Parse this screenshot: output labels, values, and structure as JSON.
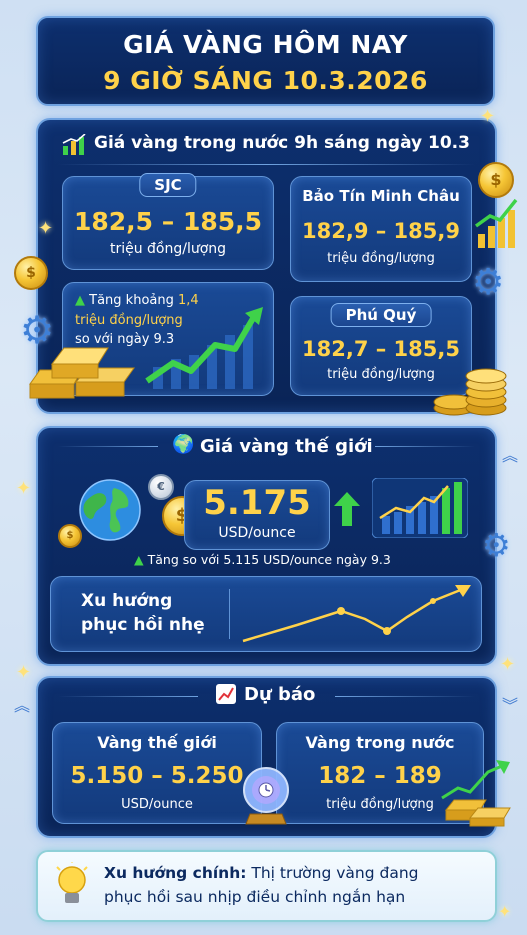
{
  "header": {
    "line1": "GIÁ VÀNG HÔM NAY",
    "line2": "9 GIỜ SÁNG 10.3.2026"
  },
  "domestic": {
    "title": "Giá vàng trong nước 9h sáng ngày 10.3",
    "sjc": {
      "name": "SJC",
      "price": "182,5 – 185,5",
      "unit": "triệu đồng/lượng"
    },
    "btmc": {
      "name": "Bảo Tín Minh Châu",
      "price": "182,9 – 185,9",
      "unit": "triệu đồng/lượng"
    },
    "phuquy": {
      "name": "Phú Quý",
      "price": "182,7 – 185,5",
      "unit": "triệu đồng/lượng"
    },
    "increase": {
      "prefix": "Tăng khoảng ",
      "amount": "1,4",
      "unit": "triệu đồng/lượng",
      "compare": "so với ngày 9.3"
    }
  },
  "world": {
    "title": "Giá vàng thế giới",
    "price": "5.175",
    "unit": "USD/ounce",
    "change_note": "Tăng so với 5.115 USD/ounce ngày 9.3",
    "trend_line1": "Xu hướng",
    "trend_line2": "phục hồi nhẹ"
  },
  "forecast": {
    "title": "Dự báo",
    "world": {
      "label": "Vàng thế giới",
      "range": "5.150 – 5.250",
      "unit": "USD/ounce"
    },
    "domestic": {
      "label": "Vàng trong nước",
      "range": "182 – 189",
      "unit": "triệu đồng/lượng"
    }
  },
  "main_trend": {
    "label": "Xu hướng chính:",
    "text_line1": " Thị trường vàng đang",
    "text_line2": "phục hồi sau nhịp điều chỉnh ngắn hạn"
  },
  "colors": {
    "gold": "#ffd24a",
    "green": "#3fd24a",
    "panel": "#0d2f6e",
    "border": "#6fa2e0"
  }
}
